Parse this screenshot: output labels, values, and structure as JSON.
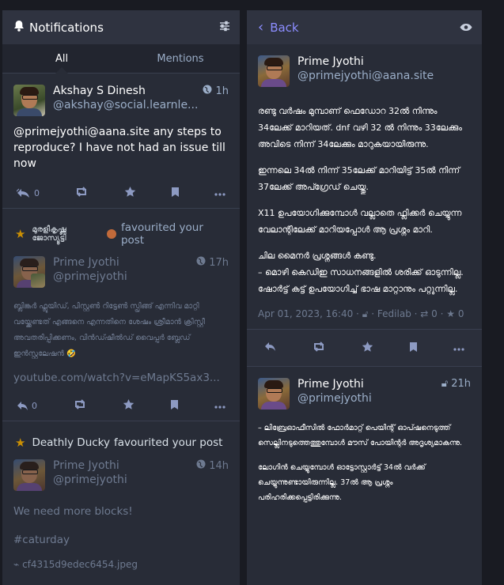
{
  "left": {
    "title": "Notifications",
    "tabs": [
      "All",
      "Mentions"
    ],
    "s1": {
      "name": "Akshay S Dinesh",
      "acct": "@akshay@social.learnle...",
      "time": "1h",
      "text": "@primejyothi@aana.site any steps to reproduce? I have not had an issue till now",
      "reply_count": "0"
    },
    "n1": {
      "actor": "മുരളീകൃഷ്ണ ജോസ്യൂട്ടി",
      "verb": "favourited your post",
      "name": "Prime Jyothi",
      "acct": "@primejyothi",
      "time": "17h",
      "text": "ബ്ലിങ്കർ ഫ്ലൂയിഡ്, പിസ്റ്റൺ റിട്ടേൺ സ്പ്രിങ്ങ് എന്നിവ മാറ്റി വയ്ക്കേണ്ടത് എങ്ങനെ എന്നതിനെ ശേഷം ശ്രീമാൻ ക്രിസ്റ്റീ അവതരിപ്പിക്കണം, വിൻഡ്ഷീൽഡ് വൈപ്പർ ബ്ലേഡ് ഇൻസ്റ്റലേഷൻ 🤣",
      "link": "youtube.com/watch?v=eMapKS5ax3...",
      "reply_count": "0"
    },
    "n2": {
      "actor": "Deathly Ducky",
      "verb": "favourited your post",
      "name": "Prime Jyothi",
      "acct": "@primejyothi",
      "time": "14h",
      "text1": "We need more blocks!",
      "text2": "#caturday",
      "file": "cf4315d9edec6454.jpeg"
    }
  },
  "right": {
    "back": "Back",
    "main": {
      "name": "Prime Jyothi",
      "acct": "@primejyothi@aana.site",
      "p1": "രണ്ടു വർഷം മുമ്പാണ് ഫെഡോറ 32ൽ നിന്നും 34ലേക്ക് മാറിയത്. dnf വഴി 32 ൽ നിന്നും 33ലേക്കും അവിടെ നിന്ന് 34ലേക്കും മാറുകയായിരുന്നു.",
      "p2": "ഇന്നലെ 34ൽ നിന്ന് 35ലേക്ക് മാറിയിട്ട് 35ൽ നിന്ന് 37ലേക്ക് അപ്ഗ്രേഡ് ചെയ്തു.",
      "p3": "X11 ഉപയോഗിക്കുമ്പോൾ വല്ലാതെ ഫ്ലിക്കർ ചെയ്യുന്ന വേലാന്റിലേക്ക് മാറിയപ്പോൾ ആ പ്രശ്നം മാറി.",
      "p4": "ചില മൈനർ പ്രശ്നങ്ങൾ കണ്ടു.",
      "p5": "– മൊഴി കെഡിഇ സാധനങ്ങളിൽ ശരിക്ക് ഓടുന്നില്ല. ഷോർട്ട് കട്ട് ഉപയോഗിച്ച് ഭാഷ മാറ്റാനും പറ്റുന്നില്ല.",
      "date": "Apr 01, 2023, 16:40",
      "app": "Fedilab",
      "boosts": "0",
      "favs": "0"
    },
    "reply": {
      "name": "Prime Jyothi",
      "acct": "@primejyothi",
      "time": "21h",
      "p1": "– ലിബ്രേഓഫീസിൽ ഫോർമാറ്റ് പെയിന്റ് ഓപ്ഷനെടുത്ത് സെല്ലിനടുത്തെത്തുമ്പോൾ മൗസ് പോയിന്റർ അദൃശ്യമാകന്നു.",
      "p2": "ലോഗിൻ ചെയ്യുമ്പോൾ ഓട്ടോസ്റ്റാർട്ട് 34ൽ വർക്ക് ചെയ്യുന്നുണ്ടായിരുന്നില്ല. 37ൽ ആ പ്രശ്നം പരിഹരിക്കപ്പെട്ടിരിക്കുന്നു."
    }
  }
}
